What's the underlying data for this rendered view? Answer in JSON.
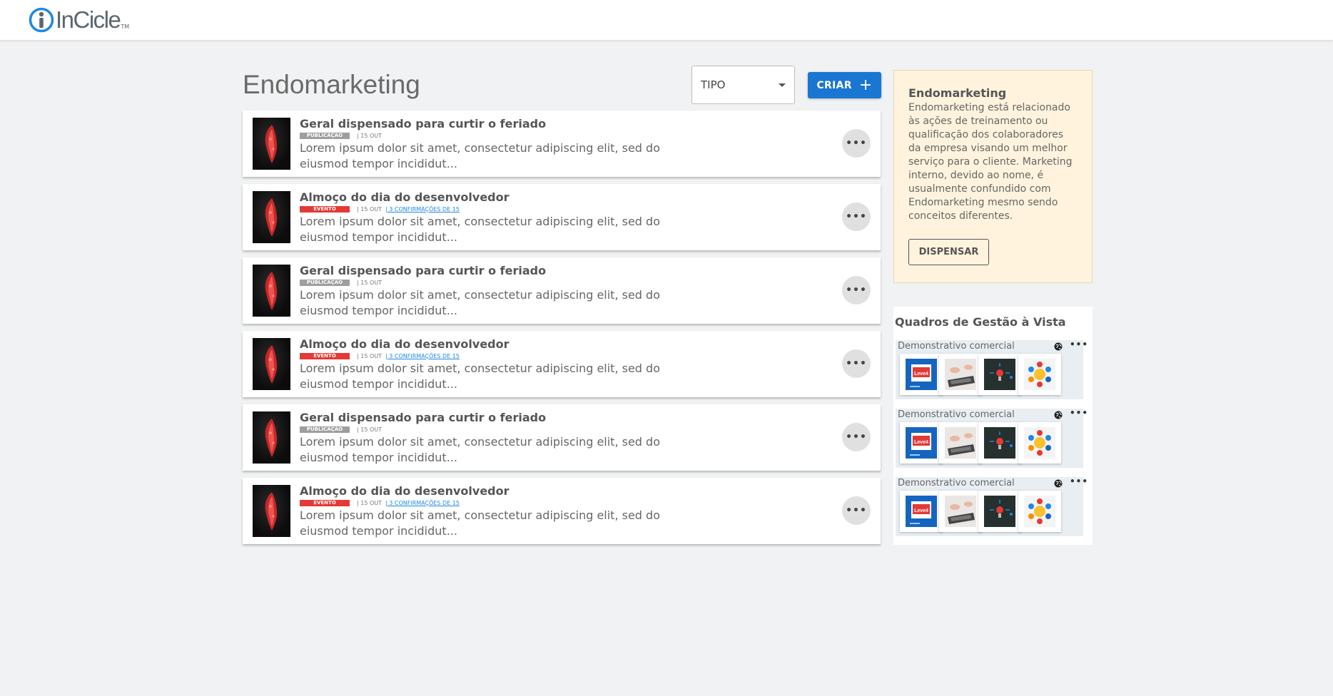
{
  "header": {
    "logo_text": "InCicle",
    "logo_tm": "TM"
  },
  "page": {
    "title": "Endomarketing"
  },
  "toolbar": {
    "type_select_value": "TIPO",
    "create_label": "CRIAR",
    "create_icon": "plus-icon"
  },
  "feed": {
    "posts": [
      {
        "title": "Geral dispensado para curtir o feriado",
        "badge": "PUBLICAÇÃO",
        "badge_color": "#9e9e9e",
        "date": "| 15 OUT",
        "confirmations": "",
        "description": "Lorem ipsum dolor sit amet, consectetur adipiscing elit, sed do eiusmod tempor incididut..."
      },
      {
        "title": "Almoço do dia do desenvolvedor",
        "badge": "EVENTO",
        "badge_color": "#e53935",
        "date": "| 15 OUT",
        "confirmations": "| 3 CONFIRMAÇÕES DE 15",
        "description": "Lorem ipsum dolor sit amet, consectetur adipiscing elit, sed do eiusmod tempor incididut..."
      },
      {
        "title": "Geral dispensado para curtir o feriado",
        "badge": "PUBLICAÇÃO",
        "badge_color": "#9e9e9e",
        "date": "| 15 OUT",
        "confirmations": "",
        "description": "Lorem ipsum dolor sit amet, consectetur adipiscing elit, sed do eiusmod tempor incididut..."
      },
      {
        "title": "Almoço do dia do desenvolvedor",
        "badge": "EVENTO",
        "badge_color": "#e53935",
        "date": "| 15 OUT",
        "confirmations": "| 3 CONFIRMAÇÕES DE 15",
        "description": "Lorem ipsum dolor sit amet, consectetur adipiscing elit, sed do eiusmod tempor incididut..."
      },
      {
        "title": "Geral dispensado para curtir o feriado",
        "badge": "PUBLICAÇÃO",
        "badge_color": "#9e9e9e",
        "date": "| 15 OUT",
        "confirmations": "",
        "description": "Lorem ipsum dolor sit amet, consectetur adipiscing elit, sed do eiusmod tempor incididut..."
      },
      {
        "title": "Almoço do dia do desenvolvedor",
        "badge": "EVENTO",
        "badge_color": "#e53935",
        "date": "| 15 OUT",
        "confirmations": "| 3 CONFIRMAÇÕES DE 15",
        "description": "Lorem ipsum dolor sit amet, consectetur adipiscing elit, sed do eiusmod tempor incididut..."
      }
    ],
    "more_icon": "more-horizontal-icon"
  },
  "info_box": {
    "title": "Endomarketing",
    "text": "Endomarketing está relacionado às ações de treinamento ou qualificação dos colaboradores da empresa visando um melhor serviço para o cliente. Marketing interno, devido ao nome, é usualmente confundido com Endomarketing mesmo sendo conceitos diferentes.",
    "dismiss_label": "DISPENSAR"
  },
  "boards": {
    "title": "Quadros de Gestão à Vista",
    "items": [
      {
        "name": "Demonstrativo comercial",
        "visibility_icon": "globe-icon",
        "tile_logo_text": "Leve4"
      },
      {
        "name": "Demonstrativo comercial",
        "visibility_icon": "globe-icon",
        "tile_logo_text": "Leve4"
      },
      {
        "name": "Demonstrativo comercial",
        "visibility_icon": "globe-icon",
        "tile_logo_text": "Leve4"
      }
    ]
  },
  "colors": {
    "primary": "#1976d2",
    "event_badge": "#e53935",
    "publication_badge": "#9e9e9e",
    "info_background": "#fff3dd"
  }
}
